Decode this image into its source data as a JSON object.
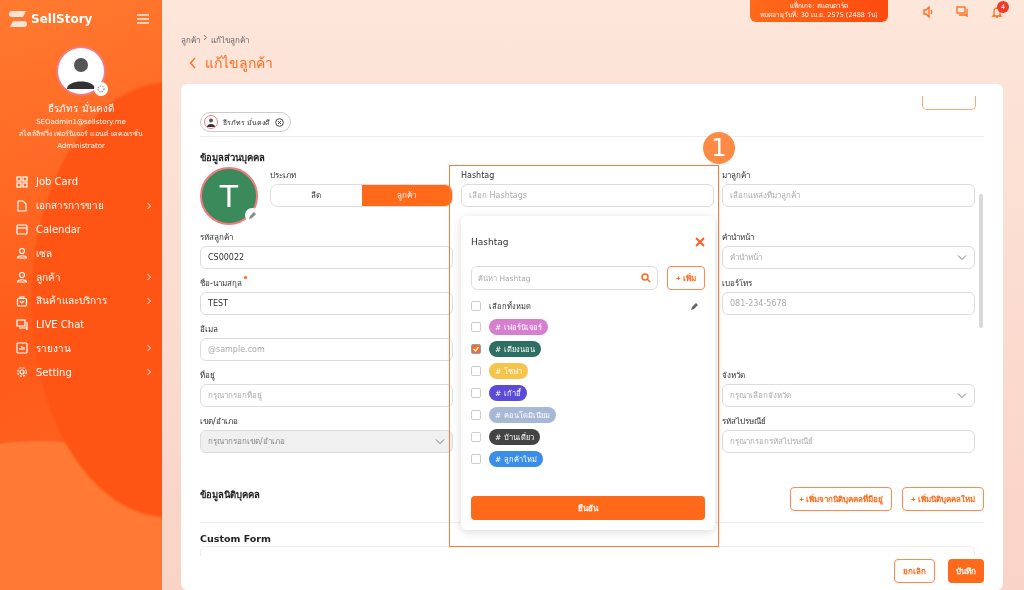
{
  "sidebar": {
    "brand": "SellStory",
    "user": {
      "name": "ธีรภัทร มั่นคงดี",
      "email": "SEOadmin1@sellstory.me",
      "shop": "สไตล์ลิฟวิ่ง เฟอร์นิเจอร์ แอนด์ เดคอเรชั่น",
      "role": "Administrator"
    },
    "items": [
      {
        "label": "Job Card",
        "has_submenu": false
      },
      {
        "label": "เอกสารการขาย",
        "has_submenu": true
      },
      {
        "label": "Calendar",
        "has_submenu": false
      },
      {
        "label": "เซล",
        "has_submenu": false
      },
      {
        "label": "ลูกค้า",
        "has_submenu": true
      },
      {
        "label": "สินค้าและบริการ",
        "has_submenu": true
      },
      {
        "label": "LIVE Chat",
        "has_submenu": false
      },
      {
        "label": "รายงาน",
        "has_submenu": true
      },
      {
        "label": "Setting",
        "has_submenu": true
      }
    ]
  },
  "topbar": {
    "package": "แพ็กเกจ: สแตนดาร์ด",
    "expiry": "หมดอายุวันที่: 30 เม.ย. 2575 (2488 วัน)",
    "notifications": "4"
  },
  "breadcrumb": [
    "ลูกค้า",
    "แก้ไขลูกค้า"
  ],
  "page_title": "แก้ไขลูกค้า",
  "owner_chip": "ธีรภัทร มั่นคงดี",
  "personal": {
    "title": "ข้อมูลส่วนบุคคล",
    "avatar_letter": "T",
    "type_label": "ประเภท",
    "types": [
      {
        "label": "ลีด",
        "selected": false
      },
      {
        "label": "ลูกค้า",
        "selected": true
      }
    ],
    "hashtag": {
      "label": "Hashtag",
      "placeholder": "เลือก Hashtags"
    },
    "source": {
      "label": "มาลูกค้า",
      "placeholder": "เลือกแหล่งที่มาลูกค้า"
    },
    "left_fields": [
      {
        "label": "รหัสลูกค้า",
        "value": "CS00022",
        "kind": "input",
        "disabled": false
      },
      {
        "label": "ชื่อ-นามสกุล",
        "required": true,
        "value": "TEST",
        "kind": "input",
        "disabled": false
      },
      {
        "label": "อีเมล",
        "placeholder": "@sample.com",
        "kind": "input",
        "disabled": false
      },
      {
        "label": "ที่อยู่",
        "placeholder": "กรุณากรอกที่อยู่",
        "kind": "input",
        "disabled": false
      },
      {
        "label": "เขต/อำเภอ",
        "placeholder": "กรุณากรอกเขต/อำเภอ",
        "kind": "select",
        "disabled": true
      }
    ],
    "right_fields": [
      {
        "label": "คำนำหน้า",
        "placeholder": "คำนำหน้า",
        "kind": "select"
      },
      {
        "label": "เบอร์โทร",
        "placeholder": "081-234-5678",
        "kind": "input"
      },
      {
        "kind": "blank"
      },
      {
        "label": "จังหวัด",
        "placeholder": "กรุณาเลือกจังหวัด",
        "kind": "select"
      },
      {
        "label": "รหัสไปรษณีย์",
        "placeholder": "กรุณากรอกรหัสไปรษณีย์",
        "kind": "input"
      }
    ]
  },
  "hashtag_popup": {
    "title": "Hashtag",
    "search_placeholder": "ค้นหา Hashtag",
    "add_button": "+ เพิ่ม",
    "select_all": {
      "label": "เลือกทั้งหมด",
      "checked": false
    },
    "tags": [
      {
        "label": "# เฟอร์นิเจอร์",
        "color": "#d67fcf",
        "checked": false
      },
      {
        "label": "# เตียงนอน",
        "color": "#2f6f63",
        "checked": true
      },
      {
        "label": "# โซฟา",
        "color": "#f7c44a",
        "checked": false
      },
      {
        "label": "# เก้าอี้",
        "color": "#5a4bd8",
        "checked": false
      },
      {
        "label": "# คอนโดมิเนียม",
        "color": "#a6b8d6",
        "checked": false
      },
      {
        "label": "# บ้านเดี่ยว",
        "color": "#444444",
        "checked": false
      },
      {
        "label": "# ลูกค้าใหม่",
        "color": "#3a8ee8",
        "checked": false
      }
    ],
    "confirm": "ยืนยัน"
  },
  "callout": "1",
  "juristic": {
    "title": "ข้อมูลนิติบุคคล",
    "buttons": [
      "+ เพิ่มจากนิติบุคคลที่มีอยู่",
      "+ เพิ่มนิติบุคคลใหม่"
    ]
  },
  "custom_form": {
    "title": "Custom Form"
  },
  "footer": {
    "cancel": "ยกเลิก",
    "save": "บันทึก"
  }
}
